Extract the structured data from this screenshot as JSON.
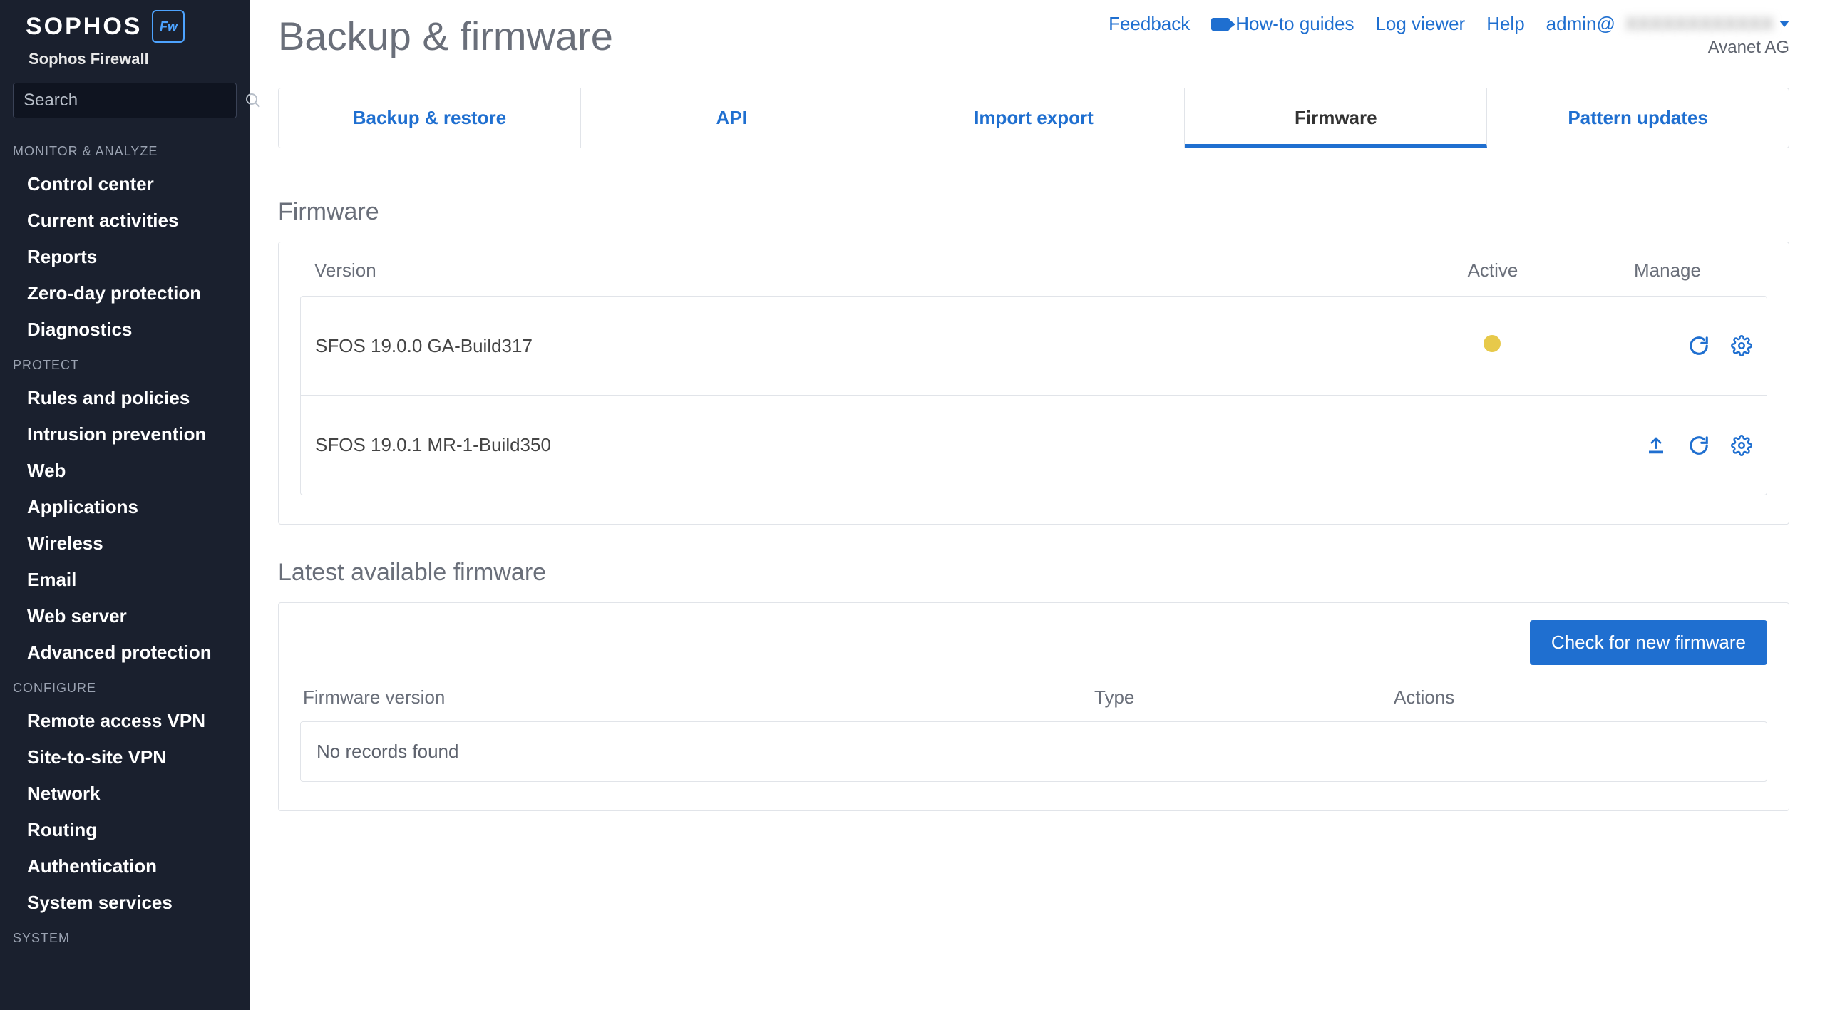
{
  "brand": {
    "name": "SOPHOS",
    "badge": "Fw",
    "subtitle": "Sophos Firewall"
  },
  "search": {
    "placeholder": "Search"
  },
  "nav": {
    "sections": [
      {
        "title": "MONITOR & ANALYZE",
        "items": [
          "Control center",
          "Current activities",
          "Reports",
          "Zero-day protection",
          "Diagnostics"
        ]
      },
      {
        "title": "PROTECT",
        "items": [
          "Rules and policies",
          "Intrusion prevention",
          "Web",
          "Applications",
          "Wireless",
          "Email",
          "Web server",
          "Advanced protection"
        ]
      },
      {
        "title": "CONFIGURE",
        "items": [
          "Remote access VPN",
          "Site-to-site VPN",
          "Network",
          "Routing",
          "Authentication",
          "System services"
        ]
      },
      {
        "title": "SYSTEM",
        "items": []
      }
    ]
  },
  "page": {
    "title": "Backup & firmware"
  },
  "top": {
    "feedback": "Feedback",
    "howto": "How-to guides",
    "logviewer": "Log viewer",
    "help": "Help",
    "user_prefix": "admin@",
    "user_blur": "XXXXXXXXXXXX",
    "org": "Avanet AG"
  },
  "tabs": [
    "Backup & restore",
    "API",
    "Import export",
    "Firmware",
    "Pattern updates"
  ],
  "active_tab": 3,
  "firmware": {
    "heading": "Firmware",
    "cols": {
      "version": "Version",
      "active": "Active",
      "manage": "Manage"
    },
    "rows": [
      {
        "version": "SFOS 19.0.0 GA-Build317",
        "active": true,
        "upload": false
      },
      {
        "version": "SFOS 19.0.1 MR-1-Build350",
        "active": false,
        "upload": true
      }
    ]
  },
  "latest": {
    "heading": "Latest available firmware",
    "button": "Check for new firmware",
    "cols": {
      "version": "Firmware version",
      "type": "Type",
      "actions": "Actions"
    },
    "empty": "No records found"
  }
}
